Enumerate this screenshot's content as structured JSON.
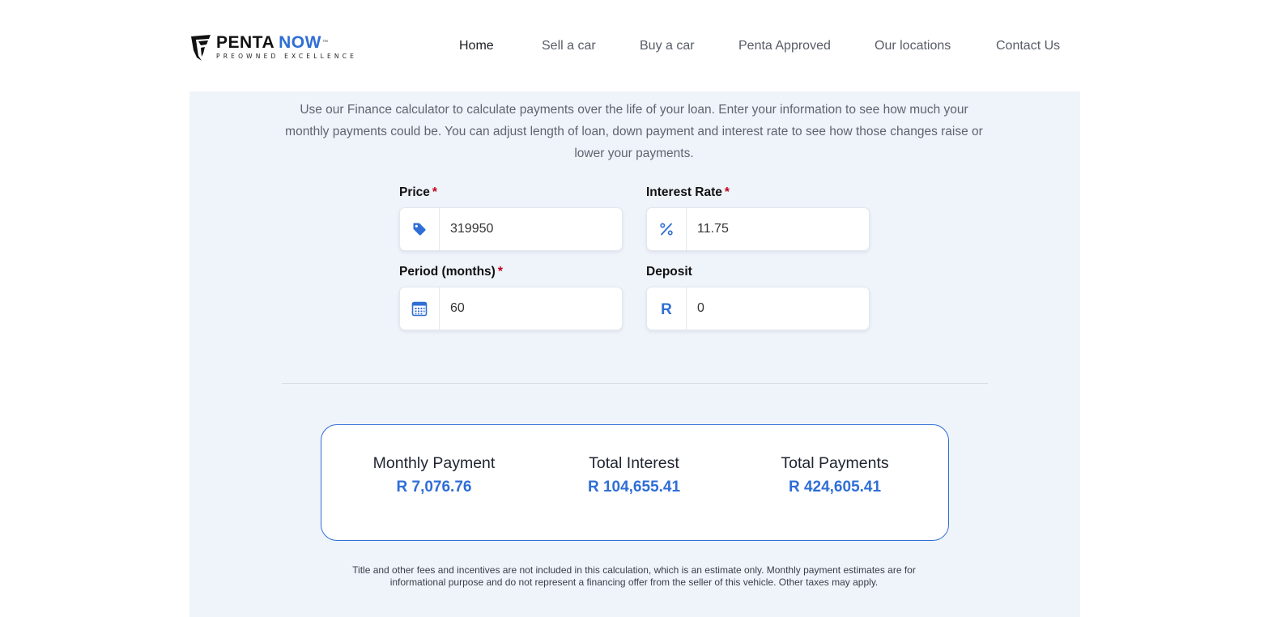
{
  "brand": {
    "name_part1": "PENTA",
    "name_part2": "NOW",
    "trademark": "™",
    "tagline": "PREOWNED EXCELLENCE",
    "accent_color": "#2f6ed6"
  },
  "nav": {
    "items": [
      {
        "label": "Home",
        "active": true
      },
      {
        "label": "Sell a car",
        "active": false
      },
      {
        "label": "Buy a car",
        "active": false
      },
      {
        "label": "Penta Approved",
        "active": false
      },
      {
        "label": "Our locations",
        "active": false
      },
      {
        "label": "Contact Us",
        "active": false
      }
    ]
  },
  "calculator": {
    "intro": "Use our Finance calculator to calculate payments over the life of your loan. Enter your information to see how much your monthly payments could be. You can adjust length of loan, down payment and interest rate to see how those changes raise or lower your payments.",
    "required_marker": "*",
    "fields": {
      "price": {
        "label": "Price",
        "value": "319950",
        "icon": "price-tag-icon",
        "required": true
      },
      "interest_rate": {
        "label": "Interest Rate",
        "value": "11.75",
        "icon": "percent-icon",
        "required": true
      },
      "period": {
        "label": "Period (months)",
        "value": "60",
        "icon": "calendar-icon",
        "required": true
      },
      "deposit": {
        "label": "Deposit",
        "value": "0",
        "icon": "rand-currency-icon",
        "icon_text": "R",
        "required": false
      }
    }
  },
  "results": {
    "monthly_payment": {
      "label": "Monthly Payment",
      "value": "R 7,076.76"
    },
    "total_interest": {
      "label": "Total Interest",
      "value": "R 104,655.41"
    },
    "total_payments": {
      "label": "Total Payments",
      "value": "R 424,605.41"
    }
  },
  "disclaimer": "Title and other fees and incentives are not included in this calculation, which is an estimate only. Monthly payment estimates are for informational purpose and do not represent a financing offer from the seller of this vehicle. Other taxes may apply."
}
